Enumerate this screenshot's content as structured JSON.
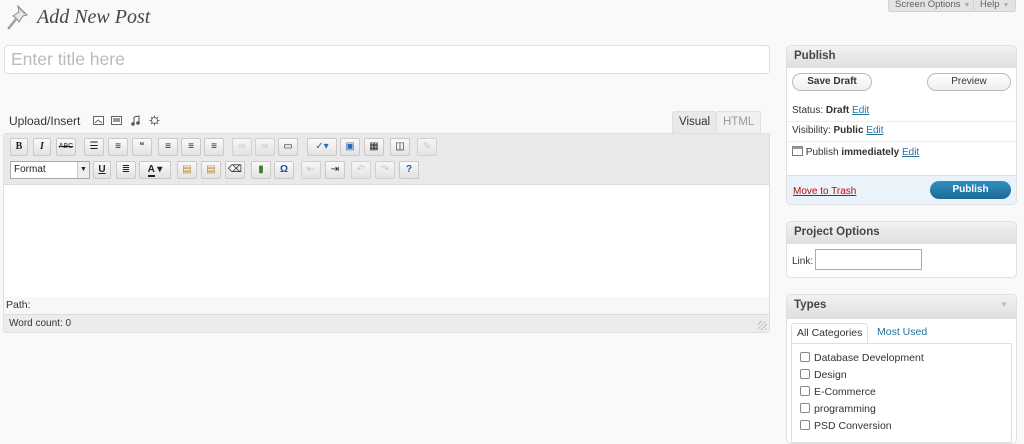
{
  "header": {
    "title": "Add New Post",
    "screen_options": "Screen Options",
    "help": "Help"
  },
  "title_input": {
    "placeholder": "Enter title here",
    "value": ""
  },
  "media": {
    "label": "Upload/Insert",
    "icons": [
      "image-icon",
      "video-icon",
      "audio-icon",
      "media-icon"
    ]
  },
  "editor": {
    "tabs": {
      "visual": "Visual",
      "html": "HTML"
    },
    "toolbar": {
      "bold": "B",
      "italic": "I",
      "strikethrough": "ABC",
      "format_select": "Format",
      "underline": "U"
    },
    "path_label": "Path:",
    "word_count": "Word count: 0"
  },
  "publish_box": {
    "title": "Publish",
    "save_draft": "Save Draft",
    "preview": "Preview",
    "status_label": "Status:",
    "status_value": "Draft",
    "visibility_label": "Visibility:",
    "visibility_value": "Public",
    "publish_label": "Publish",
    "publish_value": "immediately",
    "edit": "Edit",
    "move_to_trash": "Move to Trash",
    "publish_button": "Publish"
  },
  "project_options": {
    "title": "Project Options",
    "link_label": "Link:",
    "link_value": ""
  },
  "types": {
    "title": "Types",
    "tabs": [
      "All Categories",
      "Most Used"
    ],
    "categories": [
      "Database Development",
      "Design",
      "E-Commerce",
      "programming",
      "PSD Conversion"
    ]
  },
  "colors": {
    "link": "#21759b",
    "trash": "#bc0b0b",
    "publish_button": "#21759b",
    "background": "#f9f9f9"
  }
}
